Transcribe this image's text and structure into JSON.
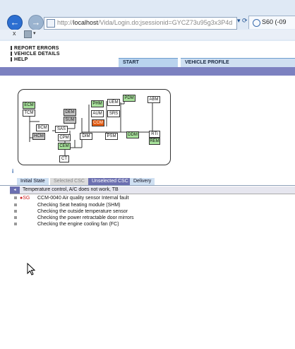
{
  "browser": {
    "url_prefix": "http://",
    "url_domain": "localhost",
    "url_path": "/Vida/Login.do;jsessionid=GYCZ73u95g3x3P4d",
    "tab_title": "S60 (-09",
    "back_glyph": "←",
    "forward_glyph": "→",
    "close_glyph": "x",
    "addr_tools": "▾ ⟳"
  },
  "menu": {
    "report_errors": "REPORT ERRORS",
    "vehicle_details": "VEHICLE DETAILS",
    "help": "HELP"
  },
  "top_tabs": {
    "start": "START",
    "vehicle_profile": "VEHICLE PROFILE"
  },
  "diagram": {
    "modules": {
      "ecm": "ECM",
      "tcm": "TCM",
      "dem": "DEM",
      "sum": "SUM",
      "bcm": "BCM",
      "sas": "SAS",
      "hcm": "HCM",
      "cpm": "CPM",
      "cem": "CEM",
      "ct": "CT",
      "phm": "PHM",
      "pdm": "PDM",
      "uem": "UEM",
      "aum": "AUM",
      "srs": "SRS",
      "ccm": "CCM",
      "dim": "DIM",
      "psm": "PSM",
      "ddm": "DDM",
      "abm": "ABM",
      "rti": "RTI",
      "rem": "REM"
    },
    "status_colors": {
      "ok": "#a8e29c",
      "fault": "#e45d14",
      "inactive": "#c7c7c7"
    }
  },
  "info_glyph": "i",
  "csc_tabs": {
    "initial": "Initial State",
    "selected": "Selected CSC",
    "unselected": "Unselected CSC",
    "delivery": "Delivery"
  },
  "fault": {
    "collapse_glyph": "◂",
    "title": "Temperature control, A/C does not work, TB",
    "rows": [
      {
        "dtc": "●SG",
        "text": "CCM-0040 Air quality sensor Internal fault"
      },
      {
        "dtc": "",
        "text": "Checking Seat heating module (SHM)"
      },
      {
        "dtc": "",
        "text": "Checking the outside temperature sensor"
      },
      {
        "dtc": "",
        "text": "Checking the power retractable door mirrors"
      },
      {
        "dtc": "",
        "text": "Checking the engine cooling fan (FC)"
      }
    ]
  }
}
